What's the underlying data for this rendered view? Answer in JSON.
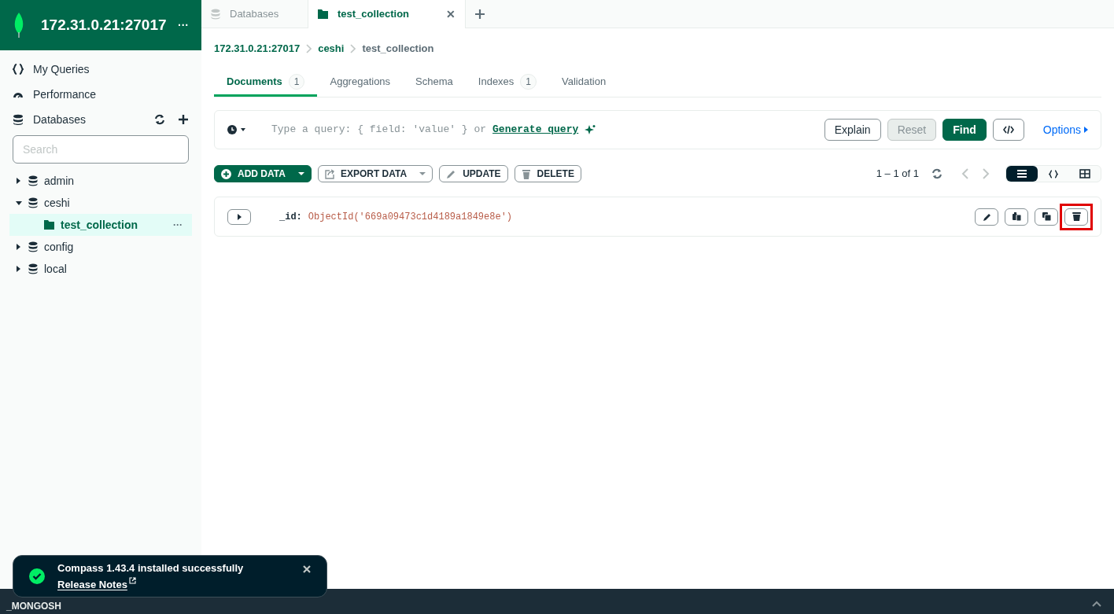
{
  "connection": {
    "title": "172.31.0.21:27017",
    "menu": "···"
  },
  "nav": [
    {
      "kind": "queries",
      "label": "My Queries"
    },
    {
      "kind": "performance",
      "label": "Performance"
    }
  ],
  "databases": {
    "label": "Databases",
    "search": {
      "placeholder": "Search"
    },
    "items": [
      {
        "name": "admin",
        "expanded": false
      },
      {
        "name": "ceshi",
        "expanded": true,
        "children": [
          {
            "name": "test_collection",
            "selected": true,
            "menu": "···"
          }
        ]
      },
      {
        "name": "config",
        "expanded": false
      },
      {
        "name": "local",
        "expanded": false
      }
    ]
  },
  "tabs": [
    {
      "kind": "databases",
      "label": "Databases",
      "selected": false
    },
    {
      "kind": "collection",
      "label": "test_collection",
      "selected": true,
      "close": "✕"
    }
  ],
  "breadcrumb": [
    {
      "label": "172.31.0.21:27017",
      "kind": "link"
    },
    {
      "label": "ceshi",
      "kind": "link"
    },
    {
      "label": "test_collection",
      "kind": "current"
    }
  ],
  "subtabs": [
    {
      "label": "Documents",
      "count": "1",
      "selected": true
    },
    {
      "label": "Aggregations",
      "selected": false
    },
    {
      "label": "Schema",
      "selected": false
    },
    {
      "label": "Indexes",
      "count": "1",
      "selected": false
    },
    {
      "label": "Validation",
      "selected": false
    }
  ],
  "query": {
    "placeholder": "Type a query: { field: 'value' } or",
    "generate": "Generate query",
    "buttons": [
      {
        "kind": "outline",
        "label": "Explain",
        "disabled": false
      },
      {
        "kind": "outline",
        "label": "Reset",
        "disabled": true
      },
      {
        "kind": "primary",
        "label": "Find",
        "disabled": false
      },
      {
        "kind": "code"
      }
    ],
    "options": "Options"
  },
  "actions": [
    {
      "kind": "add",
      "label": "ADD DATA",
      "dropdown": true
    },
    {
      "kind": "export",
      "label": "EXPORT DATA",
      "dropdown": true
    },
    {
      "kind": "update",
      "label": "UPDATE",
      "dropdown": false
    },
    {
      "kind": "delete",
      "label": "DELETE",
      "dropdown": false
    }
  ],
  "pagination": {
    "range": "1 – 1 of 1"
  },
  "views": [
    {
      "kind": "list",
      "selected": true
    },
    {
      "kind": "json",
      "selected": false
    },
    {
      "kind": "table",
      "selected": false
    }
  ],
  "documents": [
    {
      "key": "_id:",
      "value": "ObjectId('669a09473c1d4189a1849e8e')",
      "tools": [
        {
          "kind": "edit",
          "highlighted": false
        },
        {
          "kind": "copy",
          "highlighted": false
        },
        {
          "kind": "clone",
          "highlighted": false
        },
        {
          "kind": "delete",
          "highlighted": true
        }
      ]
    }
  ],
  "toast": {
    "message": "Compass 1.43.4 installed successfully",
    "link": "Release Notes"
  },
  "shell": {
    "label": "_MONGOSH"
  }
}
